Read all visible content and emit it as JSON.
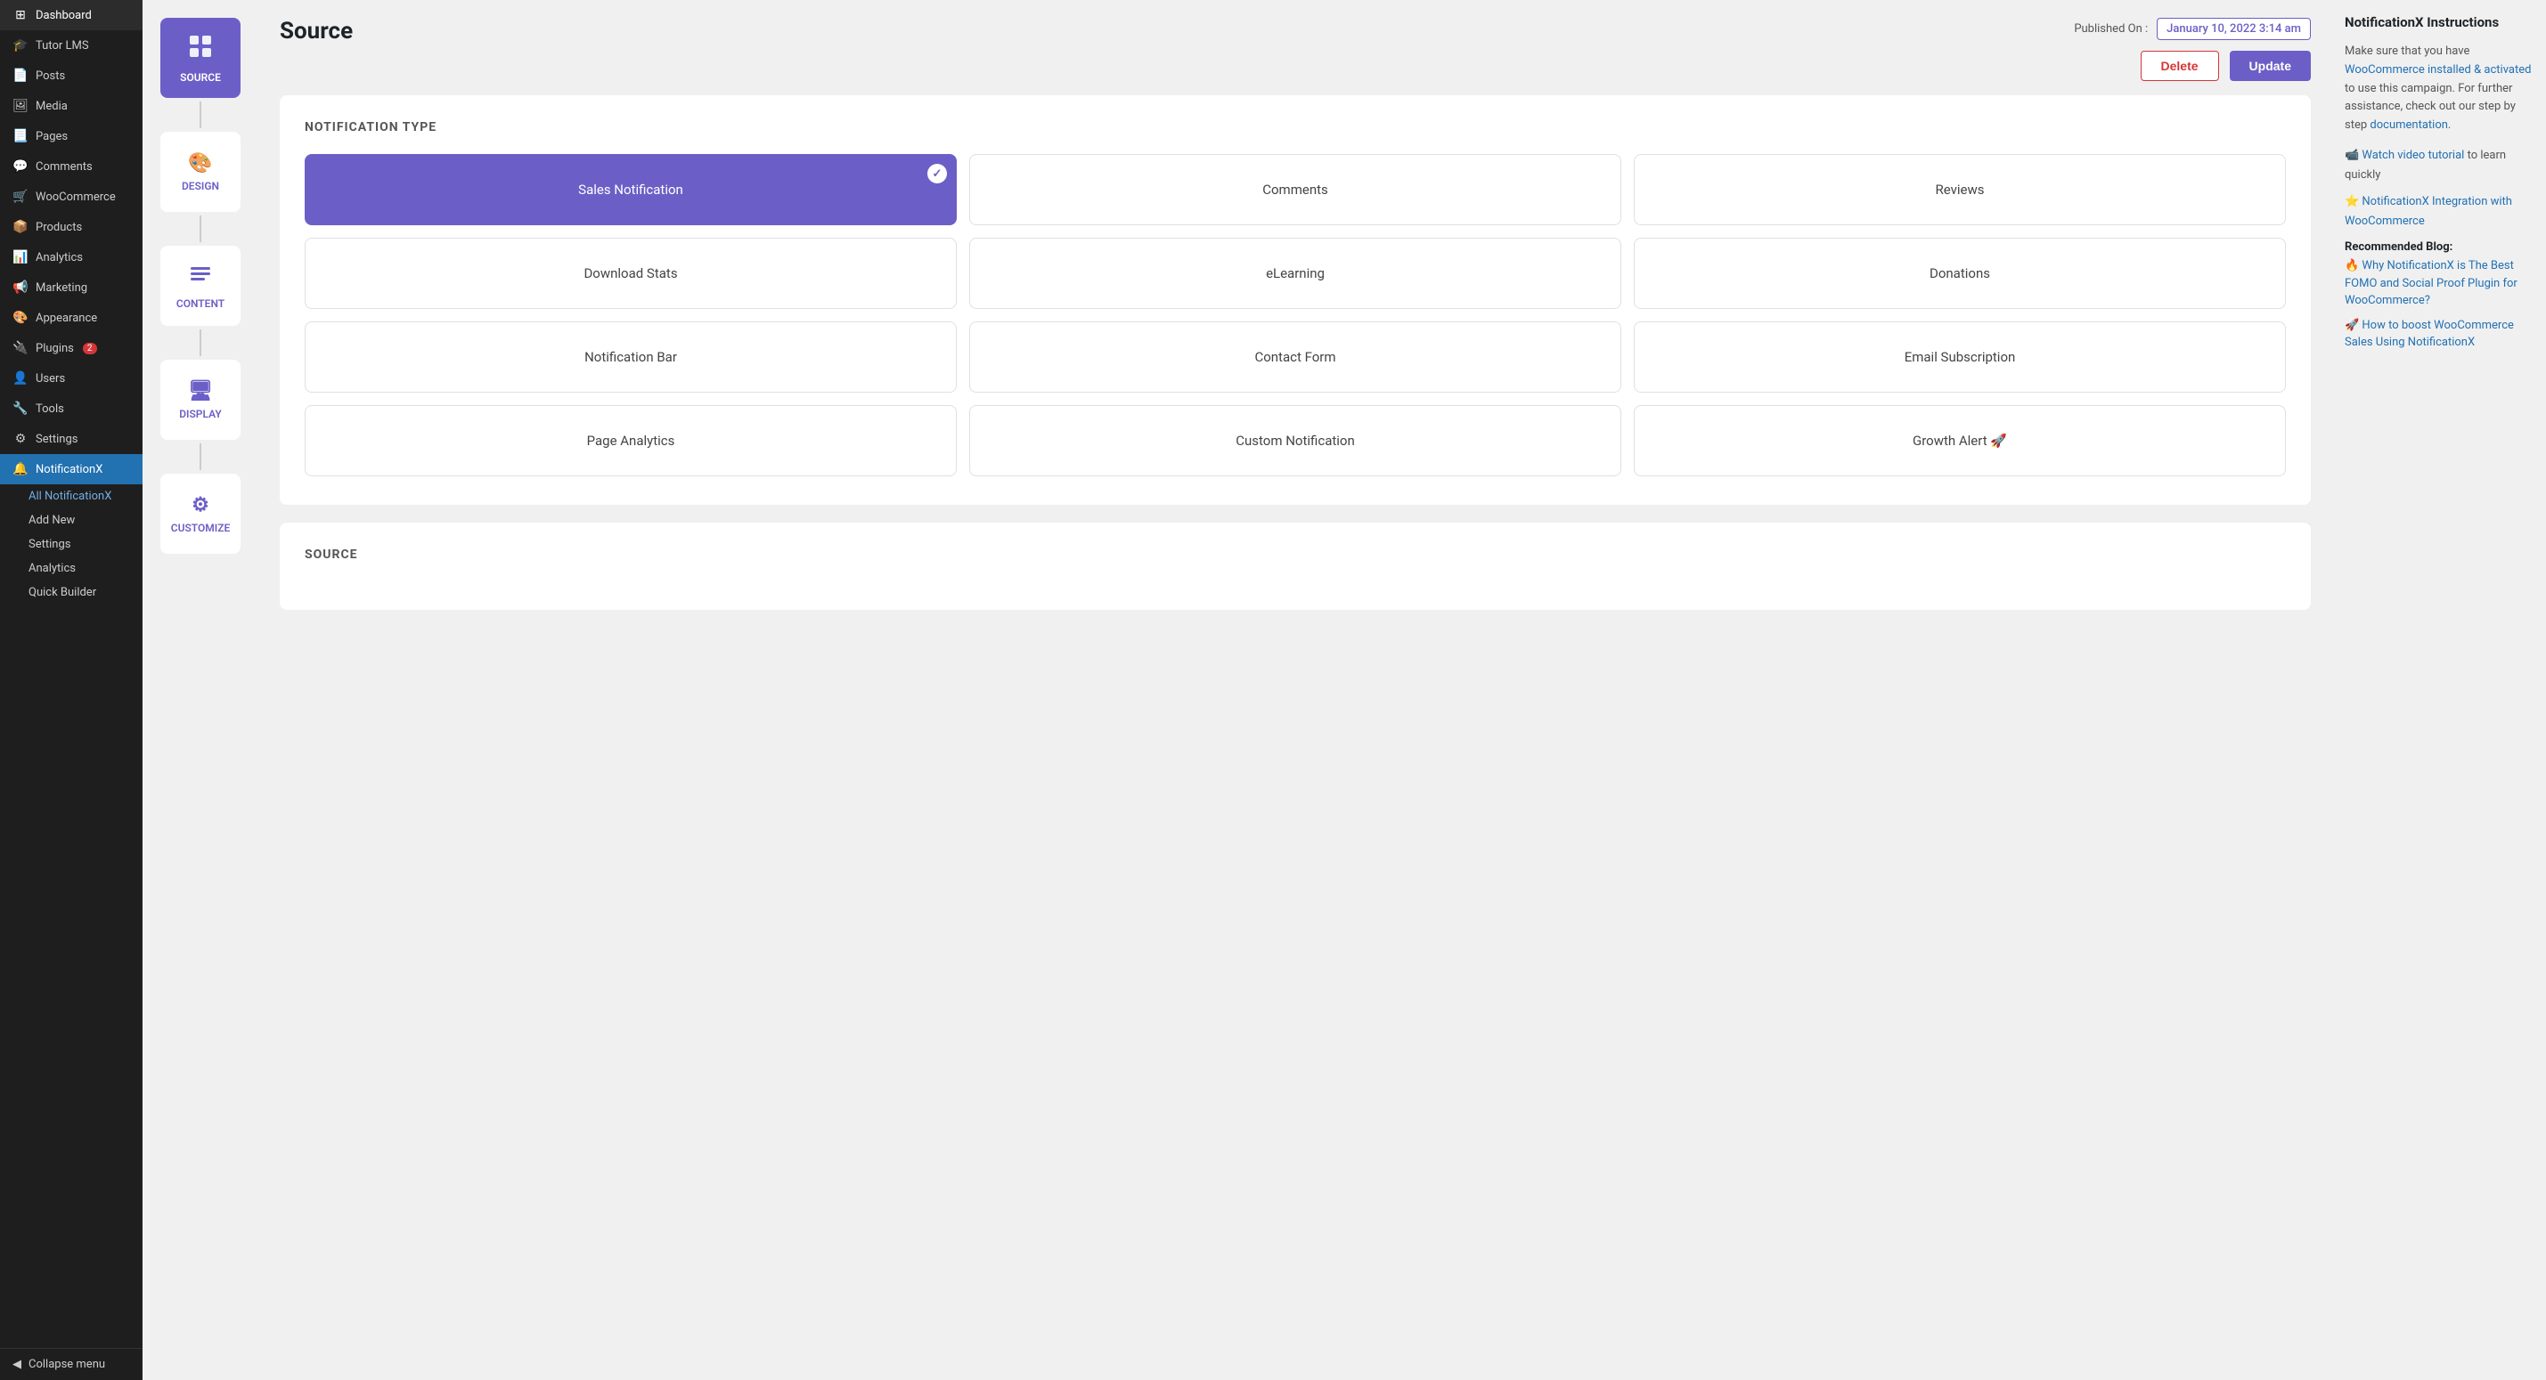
{
  "sidebar": {
    "items": [
      {
        "label": "Dashboard",
        "icon": "⊞",
        "active": false
      },
      {
        "label": "Tutor LMS",
        "icon": "🎓",
        "active": false
      },
      {
        "label": "Posts",
        "icon": "📄",
        "active": false
      },
      {
        "label": "Media",
        "icon": "🖼",
        "active": false
      },
      {
        "label": "Pages",
        "icon": "📃",
        "active": false
      },
      {
        "label": "Comments",
        "icon": "💬",
        "active": false
      },
      {
        "label": "WooCommerce",
        "icon": "🛒",
        "active": false
      },
      {
        "label": "Products",
        "icon": "📦",
        "active": false
      },
      {
        "label": "Analytics",
        "icon": "📊",
        "active": false
      },
      {
        "label": "Marketing",
        "icon": "📢",
        "active": false
      },
      {
        "label": "Appearance",
        "icon": "🎨",
        "active": false
      },
      {
        "label": "Plugins",
        "icon": "🔌",
        "active": false,
        "badge": "2"
      },
      {
        "label": "Users",
        "icon": "👤",
        "active": false
      },
      {
        "label": "Tools",
        "icon": "🔧",
        "active": false
      },
      {
        "label": "Settings",
        "icon": "⚙",
        "active": false
      },
      {
        "label": "NotificationX",
        "icon": "🔔",
        "active": true
      }
    ],
    "sub_items": [
      {
        "label": "All NotificationX",
        "active": true
      },
      {
        "label": "Add New",
        "active": false
      },
      {
        "label": "Settings",
        "active": false
      },
      {
        "label": "Analytics",
        "active": false
      },
      {
        "label": "Quick Builder",
        "active": false
      }
    ],
    "collapse_label": "Collapse menu"
  },
  "wizard": {
    "steps": [
      {
        "id": "source",
        "label": "SOURCE",
        "icon": "⬡",
        "active": true
      },
      {
        "id": "design",
        "label": "DESIGN",
        "icon": "🎨",
        "active": false
      },
      {
        "id": "content",
        "label": "CONTENT",
        "icon": "☰",
        "active": false
      },
      {
        "id": "display",
        "label": "DISPLAY",
        "icon": "🖥",
        "active": false
      },
      {
        "id": "customize",
        "label": "CUSTOMIZE",
        "icon": "⚙",
        "active": false
      }
    ]
  },
  "header": {
    "title": "Source",
    "published_on_label": "Published On :",
    "published_date": "January 10, 2022 3:14 am",
    "delete_label": "Delete",
    "update_label": "Update"
  },
  "notification_type": {
    "section_title": "NOTIFICATION TYPE",
    "cards": [
      {
        "id": "sales",
        "label": "Sales Notification",
        "selected": true
      },
      {
        "id": "comments",
        "label": "Comments",
        "selected": false
      },
      {
        "id": "reviews",
        "label": "Reviews",
        "selected": false
      },
      {
        "id": "download_stats",
        "label": "Download Stats",
        "selected": false
      },
      {
        "id": "elearning",
        "label": "eLearning",
        "selected": false
      },
      {
        "id": "donations",
        "label": "Donations",
        "selected": false
      },
      {
        "id": "notification_bar",
        "label": "Notification Bar",
        "selected": false
      },
      {
        "id": "contact_form",
        "label": "Contact Form",
        "selected": false
      },
      {
        "id": "email_subscription",
        "label": "Email Subscription",
        "selected": false
      },
      {
        "id": "page_analytics",
        "label": "Page Analytics",
        "selected": false
      },
      {
        "id": "custom_notification",
        "label": "Custom Notification",
        "selected": false
      },
      {
        "id": "growth_alert",
        "label": "Growth Alert 🚀",
        "selected": false
      }
    ]
  },
  "source_section": {
    "title": "SOURCE"
  },
  "right_panel": {
    "title": "NotificationX Instructions",
    "intro": "Make sure that you have ",
    "woo_link": "WooCommerce installed & activated",
    "intro_cont": " to use this campaign. For further assistance, check out our step by step ",
    "doc_link": "documentation",
    "doc_cont": ".",
    "video_link": "📹 Watch video tutorial",
    "video_cont": " to learn quickly",
    "integration_link": "⭐ NotificationX Integration with WooCommerce",
    "recommended_label": "Recommended Blog:",
    "blog1_link": "🔥 Why NotificationX is The Best FOMO and Social Proof Plugin",
    "blog1_cont": " for WooCommerce?",
    "blog2_link": "🚀 How to boost WooCommerce Sales",
    "blog2_cont": " Using NotificationX"
  }
}
